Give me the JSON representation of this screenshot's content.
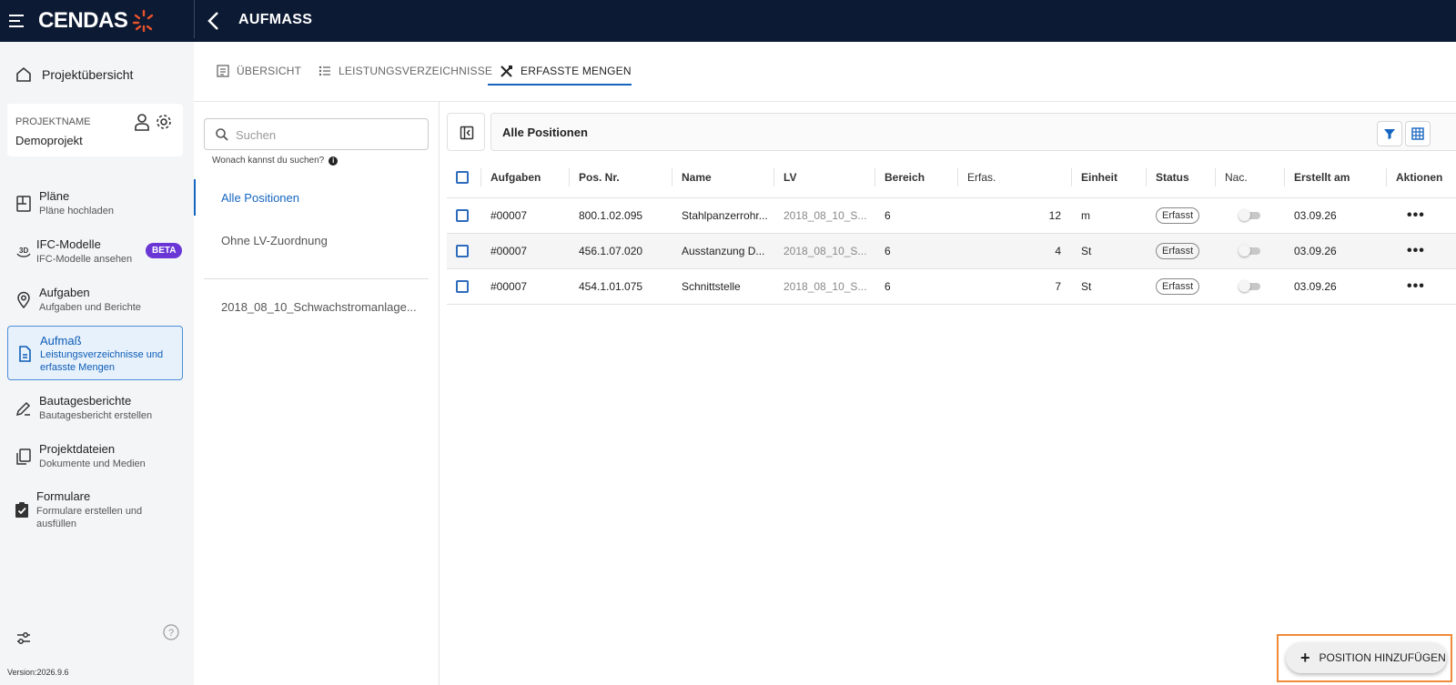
{
  "app": {
    "brand": "CENDAS",
    "page_title": "AUFMASS"
  },
  "sidebar": {
    "overview_label": "Projektübersicht",
    "project_label": "PROJEKTNAME",
    "project_name": "Demoprojekt",
    "items": [
      {
        "title": "Pläne",
        "subtitle": "Pläne hochladen",
        "icon": "plans-icon"
      },
      {
        "title": "IFC-Modelle",
        "subtitle": "IFC-Modelle ansehen",
        "icon": "3d-icon",
        "badge": "BETA"
      },
      {
        "title": "Aufgaben",
        "subtitle": "Aufgaben und Berichte",
        "icon": "location-pin-icon"
      },
      {
        "title": "Aufmaß",
        "subtitle": "Leistungsverzeichnisse und erfasste Mengen",
        "icon": "document-icon"
      },
      {
        "title": "Bautagesberichte",
        "subtitle": "Bautagesbericht erstellen",
        "icon": "pencil-icon"
      },
      {
        "title": "Projektdateien",
        "subtitle": "Dokumente und Medien",
        "icon": "files-icon"
      },
      {
        "title": "Formulare",
        "subtitle": "Formulare erstellen und ausfüllen",
        "icon": "clipboard-icon"
      }
    ],
    "active_item": "Aufmaß",
    "version": "Version:2026.9.6"
  },
  "tabs": [
    {
      "label": "ÜBERSICHT",
      "icon": "list-box-icon"
    },
    {
      "label": "LEISTUNGSVERZEICHNISSE",
      "icon": "bullet-list-icon"
    },
    {
      "label": "ERFASSTE MENGEN",
      "icon": "tools-icon"
    }
  ],
  "active_tab": "ERFASSTE MENGEN",
  "filter": {
    "search_placeholder": "Suchen",
    "search_hint": "Wonach kannst du suchen?",
    "items": [
      "Alle Positionen",
      "Ohne LV-Zuordnung",
      "2018_08_10_Schwachstromanlage..."
    ]
  },
  "content": {
    "header_title": "Alle Positionen",
    "columns": [
      "Aufgaben",
      "Pos. Nr.",
      "Name",
      "LV",
      "Bereich",
      "Erfas.",
      "Einheit",
      "Status",
      "Nac.",
      "Erstellt am",
      "Aktionen"
    ],
    "rows": [
      {
        "aufgabe": "#00007",
        "pos": "800.1.02.095",
        "name": "Stahlpanzerrohr...",
        "lv": "2018_08_10_S...",
        "bereich": "6",
        "erfasst": "12",
        "einheit": "m",
        "status": "Erfasst",
        "erstellt": "03.09.26"
      },
      {
        "aufgabe": "#00007",
        "pos": "456.1.07.020",
        "name": "Ausstanzung D...",
        "lv": "2018_08_10_S...",
        "bereich": "6",
        "erfasst": "4",
        "einheit": "St",
        "status": "Erfasst",
        "erstellt": "03.09.26"
      },
      {
        "aufgabe": "#00007",
        "pos": "454.1.01.075",
        "name": "Schnittstelle",
        "lv": "2018_08_10_S...",
        "bereich": "6",
        "erfasst": "7",
        "einheit": "St",
        "status": "Erfasst",
        "erstellt": "03.09.26"
      }
    ],
    "more_glyph": "•••"
  },
  "fab": {
    "label": "POSITION HINZUFÜGEN"
  },
  "colors": {
    "topbar": "#0c1a33",
    "accent": "#1565c0",
    "beta": "#6a37d6",
    "highlight": "#f08a38"
  }
}
